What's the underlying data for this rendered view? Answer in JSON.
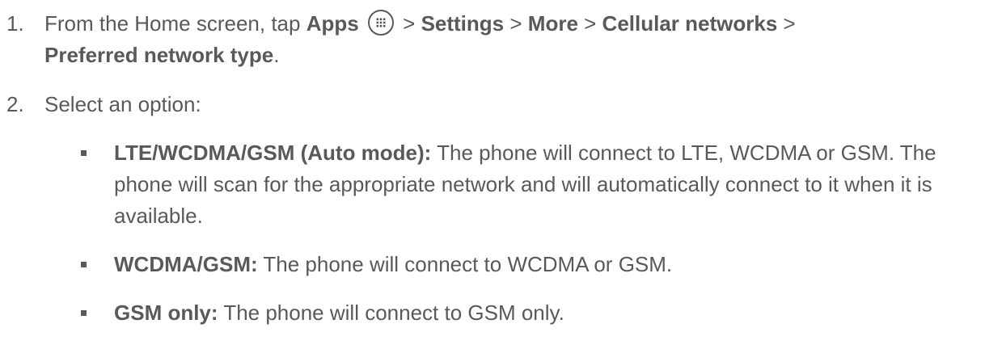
{
  "steps": [
    {
      "number": "1.",
      "text_1": "From the Home screen, tap ",
      "apps": "Apps",
      "sep_1": " > ",
      "settings": "Settings",
      "sep_2": " > ",
      "more": "More",
      "sep_3": " > ",
      "cellular": "Cellular networks",
      "sep_4": " >",
      "preferred": "Preferred network type",
      "end": "."
    },
    {
      "number": "2.",
      "text": "Select an option:"
    }
  ],
  "options": [
    {
      "label": "LTE/WCDMA/GSM (Auto mode):",
      "description": " The phone will connect to LTE, WCDMA or GSM. The phone will scan for the appropriate network and will automatically connect to it when it is available."
    },
    {
      "label": "WCDMA/GSM:",
      "description": " The phone will connect to WCDMA or GSM."
    },
    {
      "label": "GSM only:",
      "description": " The phone will connect to GSM only."
    }
  ],
  "icons": {
    "apps": "apps-grid-icon"
  }
}
